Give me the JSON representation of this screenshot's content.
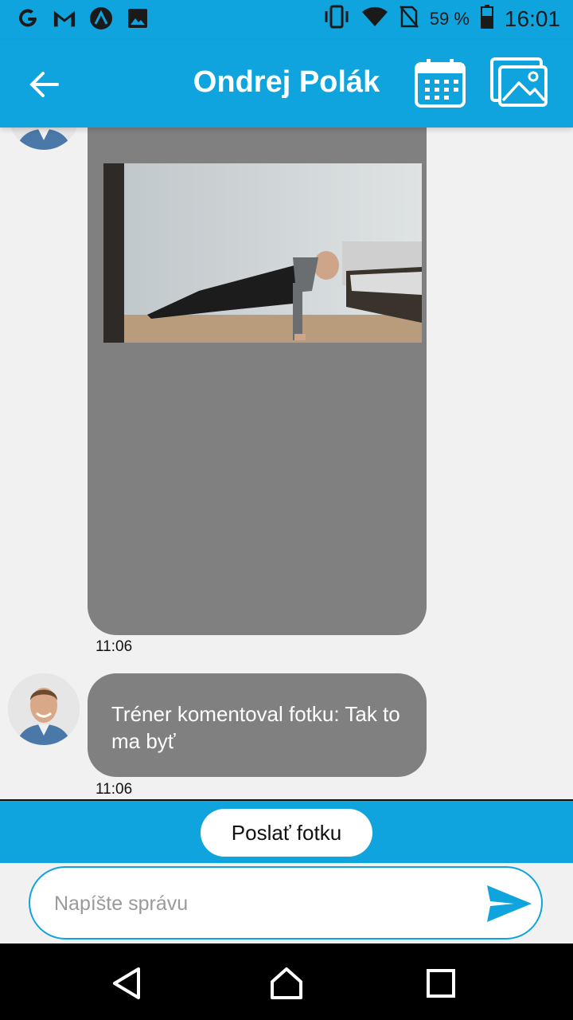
{
  "status_bar": {
    "left_icons": [
      "google-icon",
      "gmail-icon",
      "app-a-icon",
      "gallery-notification-icon"
    ],
    "right_icons": [
      "vibrate-icon",
      "wifi-icon",
      "no-sim-icon",
      "battery-icon"
    ],
    "battery_percent": "59 %",
    "time": "16:01"
  },
  "header": {
    "title": "Ondrej Polák",
    "back_icon": "arrow-back-icon",
    "calendar_icon": "calendar-icon",
    "gallery_icon": "gallery-icon"
  },
  "messages": [
    {
      "type": "photo",
      "time": "11:06"
    },
    {
      "type": "text",
      "text": "Tréner komentoval fotku: Tak to ma byť",
      "time": "11:06"
    }
  ],
  "actions": {
    "send_photo_label": "Poslať fotku"
  },
  "composer": {
    "placeholder": "Napíšte správu",
    "send_icon": "send-icon"
  },
  "nav": [
    "back-nav-icon",
    "home-nav-icon",
    "recents-nav-icon"
  ],
  "colors": {
    "accent": "#0fa4dd",
    "bubble": "#808080",
    "background": "#f1f1f1"
  }
}
